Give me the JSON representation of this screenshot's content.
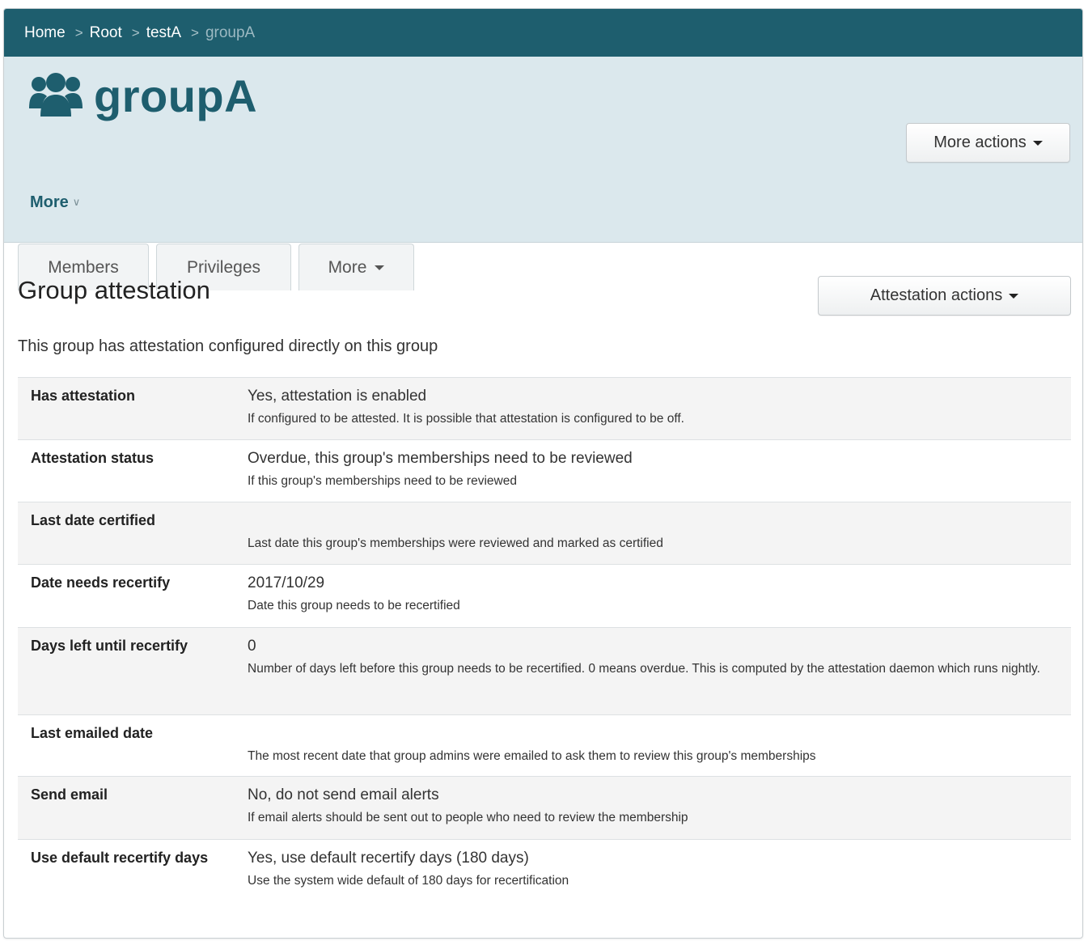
{
  "breadcrumb": {
    "items": [
      "Home",
      "Root",
      "testA"
    ],
    "current": "groupA",
    "separator": ">"
  },
  "header": {
    "icon": "users-icon",
    "title": "groupA",
    "more_label": "More",
    "more_actions_label": "More actions"
  },
  "tabs": {
    "members": "Members",
    "privileges": "Privileges",
    "more": "More"
  },
  "section": {
    "title": "Group attestation",
    "actions_label": "Attestation actions",
    "intro": "This group has attestation configured directly on this group"
  },
  "rows": [
    {
      "label": "Has attestation",
      "value": "Yes, attestation is enabled",
      "desc": "If configured to be attested. It is possible that attestation is configured to be off."
    },
    {
      "label": "Attestation status",
      "value": "Overdue, this group's memberships need to be reviewed",
      "desc": "If this group's memberships need to be reviewed"
    },
    {
      "label": "Last date certified",
      "value": "",
      "desc": "Last date this group's memberships were reviewed and marked as certified"
    },
    {
      "label": "Date needs recertify",
      "value": "2017/10/29",
      "desc": "Date this group needs to be recertified"
    },
    {
      "label": "Days left until recertify",
      "value": "0",
      "desc": "Number of days left before this group needs to be recertified. 0 means overdue. This is computed by the attestation daemon which runs nightly."
    },
    {
      "label": "Last emailed date",
      "value": "",
      "desc": "The most recent date that group admins were emailed to ask them to review this group's memberships"
    },
    {
      "label": "Send email",
      "value": "No, do not send email alerts",
      "desc": "If email alerts should be sent out to people who need to review the membership"
    },
    {
      "label": "Use default recertify days",
      "value": "Yes, use default recertify days (180 days)",
      "desc": "Use the system wide default of 180 days for recertification"
    }
  ],
  "colors": {
    "brand": "#1e5e6e",
    "header_bg": "#dbe8ed",
    "row_alt": "#f4f4f4"
  }
}
